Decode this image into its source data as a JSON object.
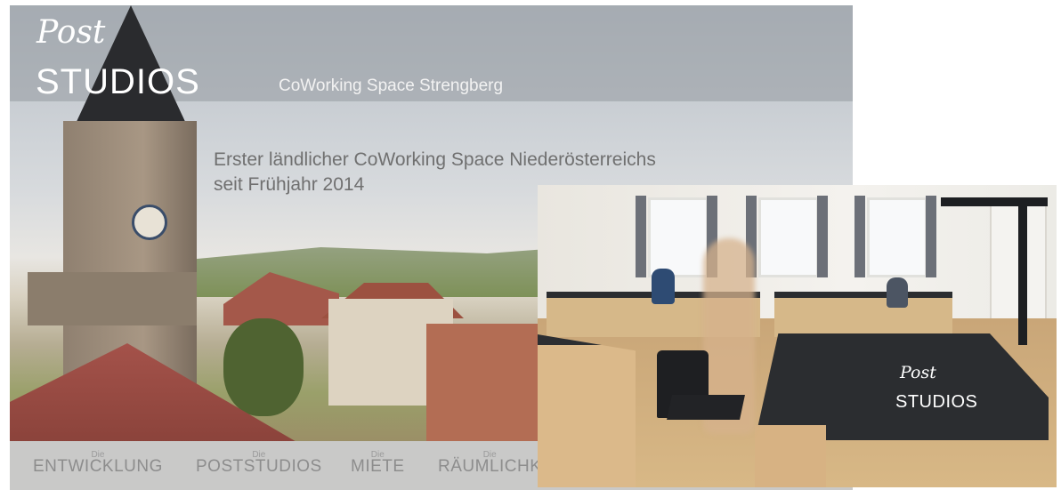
{
  "brand": {
    "script": "Post",
    "name": "STUDIOS",
    "tagline": "CoWorking Space Strengberg"
  },
  "headline": {
    "line1": "Erster ländlicher CoWorking Space Niederösterreichs",
    "line2": "seit Frühjahr 2014"
  },
  "nav": [
    {
      "prefix": "Die",
      "label": "ENTWICKLUNG"
    },
    {
      "prefix": "Die",
      "label": "POSTSTUDIOS"
    },
    {
      "prefix": "Die",
      "label": "MIETE"
    },
    {
      "prefix": "Die",
      "label": "RÄUMLICHK"
    }
  ],
  "inset": {
    "logo_script": "Post",
    "logo_name": "STUDIOS"
  }
}
